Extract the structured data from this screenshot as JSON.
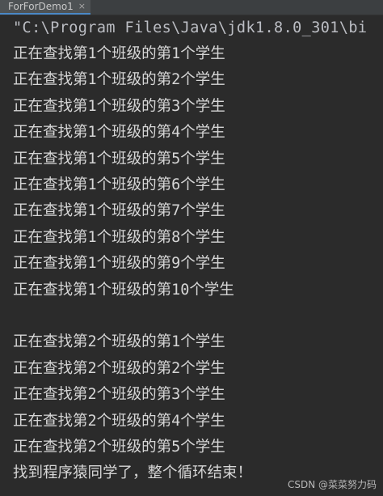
{
  "tab": {
    "title": "ForForDemo1",
    "close_glyph": "×"
  },
  "console": {
    "command": "\"C:\\Program Files\\Java\\jdk1.8.0_301\\bi",
    "lines": [
      "正在查找第1个班级的第1个学生",
      "正在查找第1个班级的第2个学生",
      "正在查找第1个班级的第3个学生",
      "正在查找第1个班级的第4个学生",
      "正在查找第1个班级的第5个学生",
      "正在查找第1个班级的第6个学生",
      "正在查找第1个班级的第7个学生",
      "正在查找第1个班级的第8个学生",
      "正在查找第1个班级的第9个学生",
      "正在查找第1个班级的第10个学生",
      "",
      "正在查找第2个班级的第1个学生",
      "正在查找第2个班级的第2个学生",
      "正在查找第2个班级的第3个学生",
      "正在查找第2个班级的第4个学生",
      "正在查找第2个班级的第5个学生",
      "找到程序猿同学了，整个循环结束！"
    ]
  },
  "watermark": {
    "text": "CSDN @菜菜努力码"
  }
}
